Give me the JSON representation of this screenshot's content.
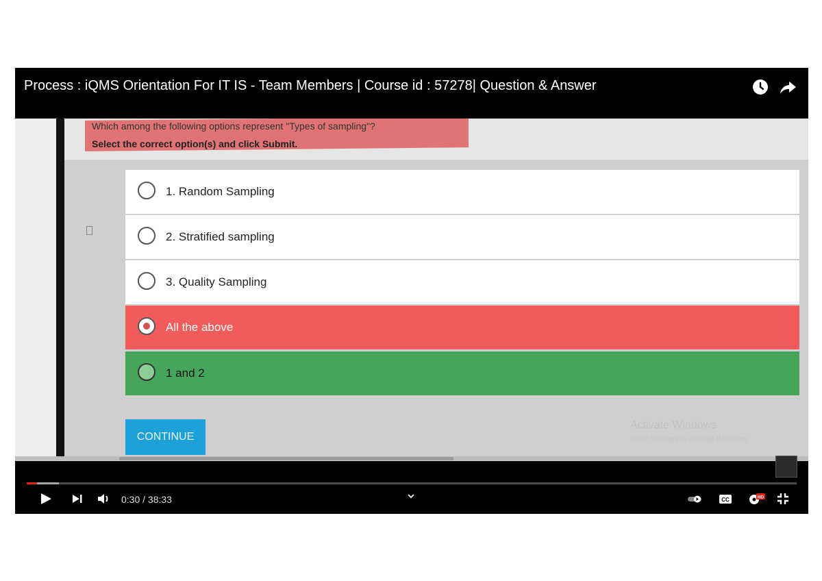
{
  "header": {
    "title": "Process : iQMS Orientation For IT IS - Team Members | Course id : 57278| Question & Answer",
    "icons": [
      "watch-later-icon",
      "share-icon"
    ]
  },
  "quiz": {
    "question": "Which among the following options represent \"Types of sampling\"?",
    "instruction": "Select the correct option(s) and click Submit.",
    "options": [
      {
        "label": "1. Random Sampling",
        "state": "unselected"
      },
      {
        "label": "2. Stratified sampling",
        "state": "unselected"
      },
      {
        "label": "3. Quality Sampling",
        "state": "unselected"
      },
      {
        "label": "All the above",
        "state": "selected-incorrect"
      },
      {
        "label": "1 and 2",
        "state": "correct"
      }
    ],
    "continue_label": "CONTINUE"
  },
  "watermark": {
    "title": "Activate Windows",
    "subtitle": "Go to Settings to activate Windows."
  },
  "player": {
    "time": "0:30 / 38:33",
    "played_fraction": 0.013,
    "buffered_fraction": 0.042,
    "icons": [
      "play-icon",
      "next-icon",
      "volume-icon",
      "chevron-down-icon",
      "autoplay-toggle-icon",
      "captions-icon",
      "settings-hd-icon",
      "exit-fullscreen-icon"
    ],
    "hd_badge": "HD",
    "cc_label": "CC"
  },
  "colors": {
    "incorrect": "#f15b5b",
    "correct": "#45a65a",
    "continue": "#1ea0d9",
    "progress": "#e62117"
  }
}
